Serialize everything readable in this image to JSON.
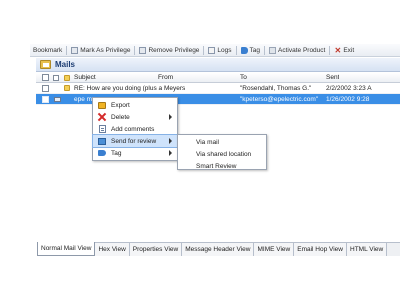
{
  "toolbar": {
    "items": [
      {
        "label": "Bookmark",
        "icon": "bookmark-icon"
      },
      {
        "label": "Mark As Privilege",
        "icon": "privilege-icon"
      },
      {
        "label": "Remove Privilege",
        "icon": "remove-privilege-icon"
      },
      {
        "label": "Logs",
        "icon": "logs-icon"
      },
      {
        "label": "Tag",
        "icon": "tag-icon"
      },
      {
        "label": "Activate Product",
        "icon": "activate-icon"
      },
      {
        "label": "Exit",
        "icon": "close-icon"
      }
    ]
  },
  "panel": {
    "title": "Mails",
    "icon": "folder-icon"
  },
  "grid": {
    "columns": [
      "Subject",
      "From",
      "To",
      "Sent"
    ],
    "rows": [
      {
        "subject": "RE: How are you doing (plus a",
        "from": "Meyers",
        "to": "\"Rosendahl, Thomas G.\"",
        "sent": "2/2/2002 3:23 A",
        "selected": false
      },
      {
        "subject": "epe mo",
        "from": "",
        "to": "\"kpeterso@epelectric.com\"",
        "sent": "1/26/2002 9:28",
        "selected": true
      }
    ]
  },
  "context_menu": {
    "items": [
      {
        "label": "Export",
        "icon": "export-icon",
        "submenu": false
      },
      {
        "label": "Delete",
        "icon": "delete-icon",
        "submenu": true
      },
      {
        "label": "Add comments",
        "icon": "comment-icon",
        "submenu": false
      },
      {
        "label": "Send for review",
        "icon": "review-icon",
        "submenu": true,
        "highlighted": true
      },
      {
        "label": "Tag",
        "icon": "tag-icon",
        "submenu": true
      }
    ]
  },
  "submenu": {
    "items": [
      {
        "label": "Via mail"
      },
      {
        "label": "Via shared location"
      },
      {
        "label": "Smart Review"
      }
    ]
  },
  "tabs": {
    "items": [
      {
        "label": "Normal Mail View",
        "active": true
      },
      {
        "label": "Hex View"
      },
      {
        "label": "Properties View"
      },
      {
        "label": "Message Header View"
      },
      {
        "label": "MIME View"
      },
      {
        "label": "Email Hop View"
      },
      {
        "label": "HTML View"
      }
    ]
  },
  "colors": {
    "selection": "#3a8ee6",
    "menu_highlight": "#cfe3fb",
    "title_text": "#1d3d73"
  }
}
